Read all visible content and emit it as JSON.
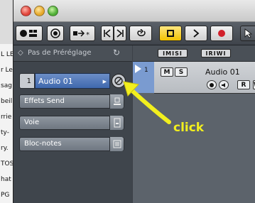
{
  "background_text": [
    "L LE",
    "r Le",
    "sag",
    "beil",
    "rrie",
    "ty-",
    "ry.",
    "TOS",
    "hat",
    "PG"
  ],
  "inspector": {
    "preset_label": "Pas de Préréglage",
    "track": {
      "number": "1",
      "name": "Audio 01"
    },
    "sections": [
      {
        "label": "Effets Send",
        "icon": "send-icon"
      },
      {
        "label": "Voie",
        "icon": "channel-icon"
      },
      {
        "label": "Bloc-notes",
        "icon": "notepad-icon"
      }
    ]
  },
  "track_list": {
    "header_buttons": [
      "IMISI",
      "IRIWI"
    ],
    "track": {
      "number": "1",
      "name": "Audio 01",
      "mute": "M",
      "solo": "S",
      "read": "R",
      "write": "W"
    }
  },
  "annotation": {
    "text": "click",
    "color": "#f2ef1e"
  }
}
